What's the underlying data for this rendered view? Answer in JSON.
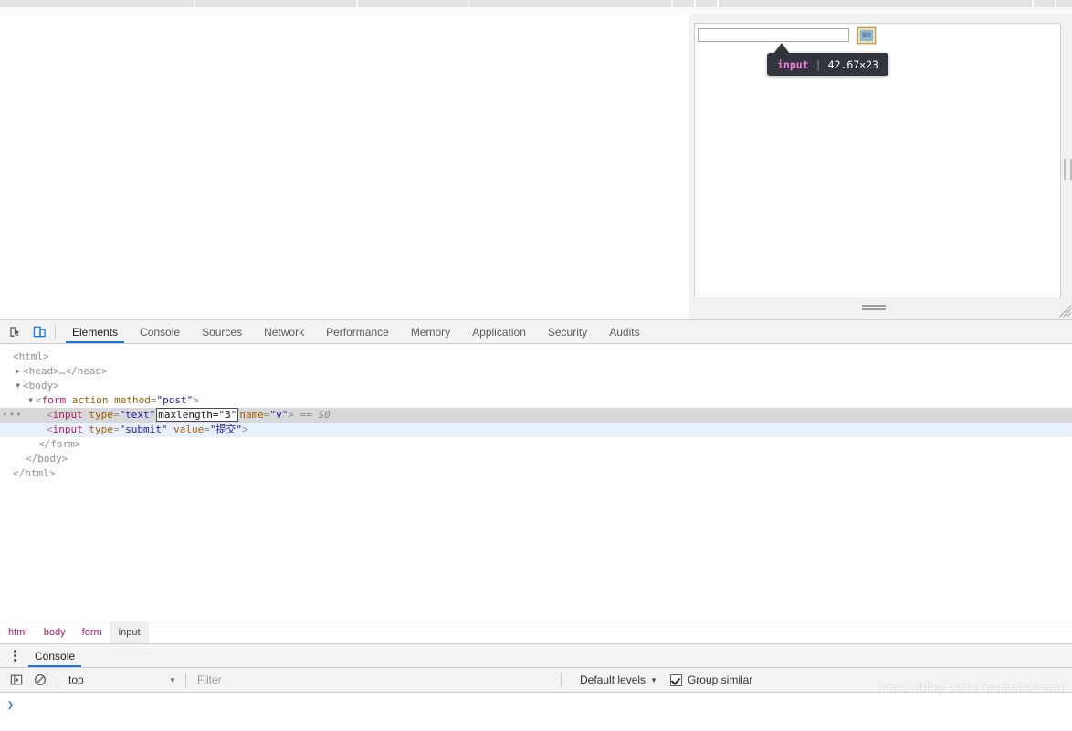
{
  "browser_chrome": {
    "divider_positions": [
      212,
      390,
      512,
      735,
      760,
      785,
      1130,
      1155
    ]
  },
  "inspected_page": {
    "text_input": {
      "value": "",
      "type": "text"
    },
    "submit_button": {
      "label": "提交",
      "type": "submit"
    },
    "highlight_tooltip": {
      "tag": "input",
      "separator": "|",
      "dimensions": "42.67×23"
    }
  },
  "devtools": {
    "toolbar_icons": [
      "inspect-element-icon",
      "device-toolbar-icon"
    ],
    "tabs": [
      {
        "label": "Elements",
        "active": true
      },
      {
        "label": "Console",
        "active": false
      },
      {
        "label": "Sources",
        "active": false
      },
      {
        "label": "Network",
        "active": false
      },
      {
        "label": "Performance",
        "active": false
      },
      {
        "label": "Memory",
        "active": false
      },
      {
        "label": "Application",
        "active": false
      },
      {
        "label": "Security",
        "active": false
      },
      {
        "label": "Audits",
        "active": false
      }
    ],
    "dom_tree": {
      "lines": [
        {
          "id": "html_open",
          "text": "<html>"
        },
        {
          "id": "head",
          "text": "<head>…</head>",
          "twisty": "▶"
        },
        {
          "id": "body_open",
          "text": "<body>",
          "twisty": "▼"
        },
        {
          "id": "form_open",
          "twisty": "▼"
        },
        {
          "id": "input_text"
        },
        {
          "id": "input_submit"
        },
        {
          "id": "form_close",
          "text": "</form>"
        },
        {
          "id": "body_close",
          "text": "</body>"
        },
        {
          "id": "html_close",
          "text": "</html>"
        }
      ],
      "form_node": {
        "open_bracket": "<",
        "tag": "form",
        "attr_action": "action",
        "attr_method": "method",
        "eq": "=",
        "method_value": "\"post\"",
        "close_bracket": ">"
      },
      "input_text_node": {
        "gutter_dots": "•••",
        "open_bracket": "<",
        "tag": "input",
        "attr_type": "type",
        "type_value": "\"text\"",
        "editing_attr": "maxlength=\"3\"",
        "attr_name": "name",
        "name_value": "\"v\"",
        "close_bracket": ">",
        "selection_marker": "== $0"
      },
      "input_submit_node": {
        "open_bracket": "<",
        "tag": "input",
        "attr_type": "type",
        "type_value": "\"submit\"",
        "attr_value": "value",
        "value_value": "\"提交\"",
        "close_bracket": ">"
      }
    },
    "breadcrumb": [
      {
        "label": "html",
        "active": false
      },
      {
        "label": "body",
        "active": false
      },
      {
        "label": "form",
        "active": false
      },
      {
        "label": "input",
        "active": true
      }
    ],
    "drawer": {
      "menu_icon": "kebab-menu-icon",
      "tabs": [
        {
          "label": "Console",
          "active": true
        }
      ],
      "toolbar": {
        "sidebar_toggle_icon": "console-sidebar-icon",
        "clear_icon": "clear-console-icon",
        "context": "top",
        "context_caret": "▼",
        "filter_placeholder": "Filter",
        "filter_value": "",
        "levels_label": "Default levels",
        "levels_caret": "▼",
        "group_similar_label": "Group similar",
        "group_similar_checked": true
      },
      "prompt_symbol": "❯"
    }
  },
  "watermark": "https://blog.csdn.net/kelisiyuan",
  "colors": {
    "accent": "#1a73e8",
    "tag": "#a71d5d",
    "attr": "#a15c00",
    "value": "#1a1aa6",
    "selected_row": "#e8f0fe",
    "hovered_row": "#d8d8d8",
    "tooltip_bg": "#33353c",
    "tooltip_tag": "#f07ede"
  }
}
